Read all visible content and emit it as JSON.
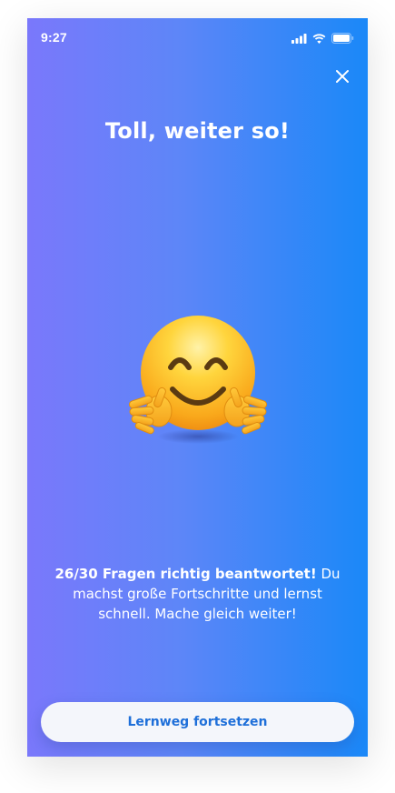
{
  "status_bar": {
    "time": "9:27"
  },
  "icons": {
    "close": "close-icon",
    "signal": "signal-icon",
    "wifi": "wifi-icon",
    "battery": "battery-icon",
    "emoji": "hugging-face-emoji"
  },
  "result": {
    "title": "Toll, weiter so!",
    "score_bold": "26/30 Fragen richtig beantwortet!",
    "message_rest": " Du machst große Fortschritte und lernst schnell. Mache gleich weiter!"
  },
  "cta": {
    "label": "Lernweg fortsetzen"
  },
  "colors": {
    "gradient_start": "#7a78fb",
    "gradient_end": "#1a88f8",
    "button_text": "#1e6fd9",
    "button_bg": "#f4f6fb"
  }
}
